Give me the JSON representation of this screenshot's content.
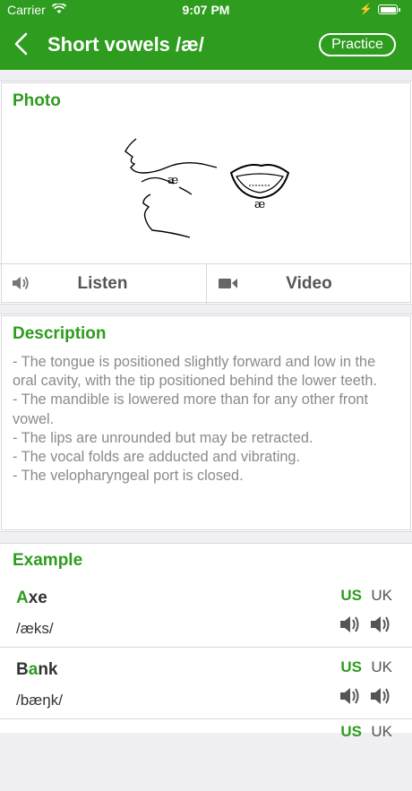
{
  "status": {
    "carrier": "Carrier",
    "time": "9:07 PM"
  },
  "nav": {
    "title": "Short vowels /æ/",
    "practice": "Practice",
    "back_icon": "chevron-left-icon"
  },
  "photo": {
    "title": "Photo",
    "symbol_face": "æ",
    "symbol_mouth": "æ",
    "listen_label": "Listen",
    "video_label": "Video",
    "listen_icon": "speaker-icon",
    "video_icon": "video-camera-icon"
  },
  "description": {
    "title": "Description",
    "lines": [
      "- The tongue is positioned slightly forward and low in the oral cavity, with the tip positioned behind the lower teeth.",
      "- The mandible is lowered more than for any other front vowel.",
      "- The lips are unrounded but may be retracted.",
      "- The vocal folds are adducted and vibrating.",
      "- The velopharyngeal port is closed."
    ]
  },
  "example": {
    "title": "Example",
    "words": [
      {
        "pre": "",
        "hl": "A",
        "post": "xe",
        "ipa": "/æks/",
        "us": "US",
        "uk": "UK"
      },
      {
        "pre": "B",
        "hl": "a",
        "post": "nk",
        "ipa": "/bæŋk/",
        "us": "US",
        "uk": "UK"
      }
    ],
    "partial": {
      "us": "US",
      "uk": "UK"
    }
  },
  "colors": {
    "accent": "#2e9c1e",
    "background": "#efeff4"
  }
}
